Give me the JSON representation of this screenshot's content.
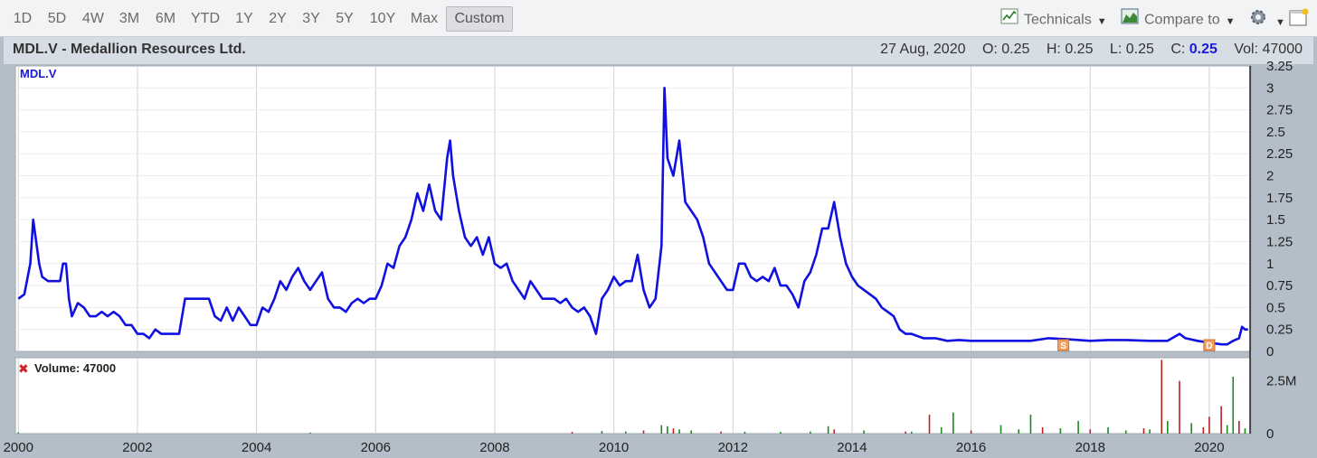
{
  "toolbar": {
    "ranges": [
      "1D",
      "5D",
      "4W",
      "3M",
      "6M",
      "YTD",
      "1Y",
      "2Y",
      "3Y",
      "5Y",
      "10Y",
      "Max",
      "Custom"
    ],
    "active_range": "Custom",
    "technicals_label": "Technicals",
    "compare_label": "Compare to"
  },
  "header": {
    "title": "MDL.V - Medallion Resources Ltd.",
    "date": "27 Aug, 2020",
    "open_label": "O:",
    "open": "0.25",
    "high_label": "H:",
    "high": "0.25",
    "low_label": "L:",
    "low": "0.25",
    "close_label": "C:",
    "close": "0.25",
    "vol_label": "Vol:",
    "vol": "47000"
  },
  "colors": {
    "price_line": "#1010e0",
    "volume_up": "#1a8a1a",
    "volume_down": "#c02020",
    "grid": "#d0d0d0"
  },
  "chart_data": {
    "type": "line",
    "price_label": "MDL.V",
    "volume_label": "Volume: 47000",
    "x_range": [
      1999.95,
      2020.7
    ],
    "y_range": [
      0,
      3.25
    ],
    "x_ticks": [
      "2000",
      "2002",
      "2004",
      "2006",
      "2008",
      "2010",
      "2012",
      "2014",
      "2016",
      "2018",
      "2020"
    ],
    "y_ticks": [
      "3.25",
      "3",
      "2.75",
      "2.5",
      "2.25",
      "2",
      "1.75",
      "1.5",
      "1.25",
      "1",
      "0.75",
      "0.5",
      "0.25",
      "0"
    ],
    "volume_ticks": [
      "2.5M",
      "0"
    ],
    "volume_range": [
      0,
      3600000
    ],
    "price_points": [
      [
        2000.0,
        0.6
      ],
      [
        2000.1,
        0.65
      ],
      [
        2000.2,
        1.0
      ],
      [
        2000.25,
        1.5
      ],
      [
        2000.3,
        1.25
      ],
      [
        2000.35,
        1.0
      ],
      [
        2000.4,
        0.85
      ],
      [
        2000.5,
        0.8
      ],
      [
        2000.6,
        0.8
      ],
      [
        2000.7,
        0.8
      ],
      [
        2000.75,
        1.0
      ],
      [
        2000.8,
        1.0
      ],
      [
        2000.85,
        0.6
      ],
      [
        2000.9,
        0.4
      ],
      [
        2001.0,
        0.55
      ],
      [
        2001.1,
        0.5
      ],
      [
        2001.2,
        0.4
      ],
      [
        2001.3,
        0.4
      ],
      [
        2001.4,
        0.45
      ],
      [
        2001.5,
        0.4
      ],
      [
        2001.6,
        0.45
      ],
      [
        2001.7,
        0.4
      ],
      [
        2001.8,
        0.3
      ],
      [
        2001.9,
        0.3
      ],
      [
        2002.0,
        0.2
      ],
      [
        2002.1,
        0.2
      ],
      [
        2002.2,
        0.15
      ],
      [
        2002.3,
        0.25
      ],
      [
        2002.4,
        0.2
      ],
      [
        2002.5,
        0.2
      ],
      [
        2002.6,
        0.2
      ],
      [
        2002.7,
        0.2
      ],
      [
        2002.8,
        0.6
      ],
      [
        2002.9,
        0.6
      ],
      [
        2003.0,
        0.6
      ],
      [
        2003.2,
        0.6
      ],
      [
        2003.3,
        0.4
      ],
      [
        2003.4,
        0.35
      ],
      [
        2003.5,
        0.5
      ],
      [
        2003.6,
        0.35
      ],
      [
        2003.7,
        0.5
      ],
      [
        2003.8,
        0.4
      ],
      [
        2003.9,
        0.3
      ],
      [
        2004.0,
        0.3
      ],
      [
        2004.1,
        0.5
      ],
      [
        2004.2,
        0.45
      ],
      [
        2004.3,
        0.6
      ],
      [
        2004.4,
        0.8
      ],
      [
        2004.5,
        0.7
      ],
      [
        2004.6,
        0.85
      ],
      [
        2004.7,
        0.95
      ],
      [
        2004.8,
        0.8
      ],
      [
        2004.9,
        0.7
      ],
      [
        2005.0,
        0.8
      ],
      [
        2005.1,
        0.9
      ],
      [
        2005.2,
        0.6
      ],
      [
        2005.3,
        0.5
      ],
      [
        2005.4,
        0.5
      ],
      [
        2005.5,
        0.45
      ],
      [
        2005.6,
        0.55
      ],
      [
        2005.7,
        0.6
      ],
      [
        2005.8,
        0.55
      ],
      [
        2005.9,
        0.6
      ],
      [
        2006.0,
        0.6
      ],
      [
        2006.1,
        0.75
      ],
      [
        2006.2,
        1.0
      ],
      [
        2006.3,
        0.95
      ],
      [
        2006.4,
        1.2
      ],
      [
        2006.5,
        1.3
      ],
      [
        2006.6,
        1.5
      ],
      [
        2006.7,
        1.8
      ],
      [
        2006.8,
        1.6
      ],
      [
        2006.9,
        1.9
      ],
      [
        2007.0,
        1.6
      ],
      [
        2007.1,
        1.5
      ],
      [
        2007.2,
        2.2
      ],
      [
        2007.25,
        2.4
      ],
      [
        2007.3,
        2.0
      ],
      [
        2007.4,
        1.6
      ],
      [
        2007.5,
        1.3
      ],
      [
        2007.6,
        1.2
      ],
      [
        2007.7,
        1.3
      ],
      [
        2007.8,
        1.1
      ],
      [
        2007.9,
        1.3
      ],
      [
        2008.0,
        1.0
      ],
      [
        2008.1,
        0.95
      ],
      [
        2008.2,
        1.0
      ],
      [
        2008.3,
        0.8
      ],
      [
        2008.4,
        0.7
      ],
      [
        2008.5,
        0.6
      ],
      [
        2008.6,
        0.8
      ],
      [
        2008.7,
        0.7
      ],
      [
        2008.8,
        0.6
      ],
      [
        2008.9,
        0.6
      ],
      [
        2009.0,
        0.6
      ],
      [
        2009.1,
        0.55
      ],
      [
        2009.2,
        0.6
      ],
      [
        2009.3,
        0.5
      ],
      [
        2009.4,
        0.45
      ],
      [
        2009.5,
        0.5
      ],
      [
        2009.6,
        0.4
      ],
      [
        2009.7,
        0.2
      ],
      [
        2009.8,
        0.6
      ],
      [
        2009.9,
        0.7
      ],
      [
        2010.0,
        0.85
      ],
      [
        2010.1,
        0.75
      ],
      [
        2010.2,
        0.8
      ],
      [
        2010.3,
        0.8
      ],
      [
        2010.4,
        1.1
      ],
      [
        2010.5,
        0.7
      ],
      [
        2010.6,
        0.5
      ],
      [
        2010.7,
        0.6
      ],
      [
        2010.8,
        1.2
      ],
      [
        2010.85,
        3.0
      ],
      [
        2010.9,
        2.2
      ],
      [
        2011.0,
        2.0
      ],
      [
        2011.1,
        2.4
      ],
      [
        2011.2,
        1.7
      ],
      [
        2011.3,
        1.6
      ],
      [
        2011.4,
        1.5
      ],
      [
        2011.5,
        1.3
      ],
      [
        2011.6,
        1.0
      ],
      [
        2011.7,
        0.9
      ],
      [
        2011.8,
        0.8
      ],
      [
        2011.9,
        0.7
      ],
      [
        2012.0,
        0.7
      ],
      [
        2012.1,
        1.0
      ],
      [
        2012.2,
        1.0
      ],
      [
        2012.3,
        0.85
      ],
      [
        2012.4,
        0.8
      ],
      [
        2012.5,
        0.85
      ],
      [
        2012.6,
        0.8
      ],
      [
        2012.7,
        0.95
      ],
      [
        2012.8,
        0.75
      ],
      [
        2012.9,
        0.75
      ],
      [
        2013.0,
        0.65
      ],
      [
        2013.1,
        0.5
      ],
      [
        2013.2,
        0.8
      ],
      [
        2013.3,
        0.9
      ],
      [
        2013.4,
        1.1
      ],
      [
        2013.5,
        1.4
      ],
      [
        2013.6,
        1.4
      ],
      [
        2013.7,
        1.7
      ],
      [
        2013.8,
        1.3
      ],
      [
        2013.9,
        1.0
      ],
      [
        2014.0,
        0.85
      ],
      [
        2014.1,
        0.75
      ],
      [
        2014.2,
        0.7
      ],
      [
        2014.3,
        0.65
      ],
      [
        2014.4,
        0.6
      ],
      [
        2014.5,
        0.5
      ],
      [
        2014.6,
        0.45
      ],
      [
        2014.7,
        0.4
      ],
      [
        2014.8,
        0.25
      ],
      [
        2014.9,
        0.2
      ],
      [
        2015.0,
        0.2
      ],
      [
        2015.2,
        0.15
      ],
      [
        2015.4,
        0.15
      ],
      [
        2015.6,
        0.12
      ],
      [
        2015.8,
        0.13
      ],
      [
        2016.0,
        0.12
      ],
      [
        2016.3,
        0.12
      ],
      [
        2016.6,
        0.12
      ],
      [
        2017.0,
        0.12
      ],
      [
        2017.3,
        0.15
      ],
      [
        2017.6,
        0.14
      ],
      [
        2018.0,
        0.12
      ],
      [
        2018.3,
        0.13
      ],
      [
        2018.6,
        0.13
      ],
      [
        2019.0,
        0.12
      ],
      [
        2019.3,
        0.12
      ],
      [
        2019.5,
        0.2
      ],
      [
        2019.6,
        0.15
      ],
      [
        2019.8,
        0.12
      ],
      [
        2020.0,
        0.1
      ],
      [
        2020.2,
        0.08
      ],
      [
        2020.3,
        0.08
      ],
      [
        2020.4,
        0.12
      ],
      [
        2020.5,
        0.15
      ],
      [
        2020.55,
        0.28
      ],
      [
        2020.6,
        0.25
      ],
      [
        2020.65,
        0.25
      ]
    ],
    "volume_bars": [
      [
        2000.0,
        60000,
        "up"
      ],
      [
        2004.9,
        50000,
        "up"
      ],
      [
        2009.3,
        80000,
        "down"
      ],
      [
        2009.8,
        120000,
        "up"
      ],
      [
        2010.2,
        100000,
        "up"
      ],
      [
        2010.5,
        150000,
        "down"
      ],
      [
        2010.8,
        400000,
        "up"
      ],
      [
        2010.9,
        350000,
        "up"
      ],
      [
        2011.0,
        250000,
        "down"
      ],
      [
        2011.1,
        200000,
        "up"
      ],
      [
        2011.3,
        150000,
        "up"
      ],
      [
        2011.8,
        100000,
        "down"
      ],
      [
        2012.2,
        90000,
        "up"
      ],
      [
        2012.8,
        80000,
        "up"
      ],
      [
        2013.3,
        100000,
        "up"
      ],
      [
        2013.6,
        350000,
        "up"
      ],
      [
        2013.7,
        200000,
        "down"
      ],
      [
        2014.2,
        150000,
        "up"
      ],
      [
        2014.9,
        100000,
        "down"
      ],
      [
        2015.0,
        90000,
        "up"
      ],
      [
        2015.3,
        900000,
        "down"
      ],
      [
        2015.5,
        300000,
        "up"
      ],
      [
        2015.7,
        1000000,
        "up"
      ],
      [
        2016.0,
        150000,
        "down"
      ],
      [
        2016.5,
        400000,
        "up"
      ],
      [
        2016.8,
        200000,
        "up"
      ],
      [
        2017.0,
        900000,
        "up"
      ],
      [
        2017.2,
        300000,
        "down"
      ],
      [
        2017.5,
        250000,
        "up"
      ],
      [
        2017.8,
        600000,
        "up"
      ],
      [
        2018.0,
        200000,
        "down"
      ],
      [
        2018.3,
        300000,
        "up"
      ],
      [
        2018.6,
        150000,
        "up"
      ],
      [
        2018.9,
        250000,
        "down"
      ],
      [
        2019.0,
        200000,
        "up"
      ],
      [
        2019.2,
        3500000,
        "down"
      ],
      [
        2019.3,
        600000,
        "up"
      ],
      [
        2019.5,
        2500000,
        "down"
      ],
      [
        2019.7,
        500000,
        "up"
      ],
      [
        2019.9,
        300000,
        "down"
      ],
      [
        2020.0,
        800000,
        "down"
      ],
      [
        2020.2,
        1300000,
        "down"
      ],
      [
        2020.3,
        400000,
        "up"
      ],
      [
        2020.4,
        2700000,
        "up"
      ],
      [
        2020.5,
        600000,
        "down"
      ],
      [
        2020.6,
        250000,
        "up"
      ]
    ],
    "markers": [
      {
        "x": 2017.55,
        "label": "S"
      },
      {
        "x": 2020.0,
        "label": "D"
      }
    ]
  }
}
